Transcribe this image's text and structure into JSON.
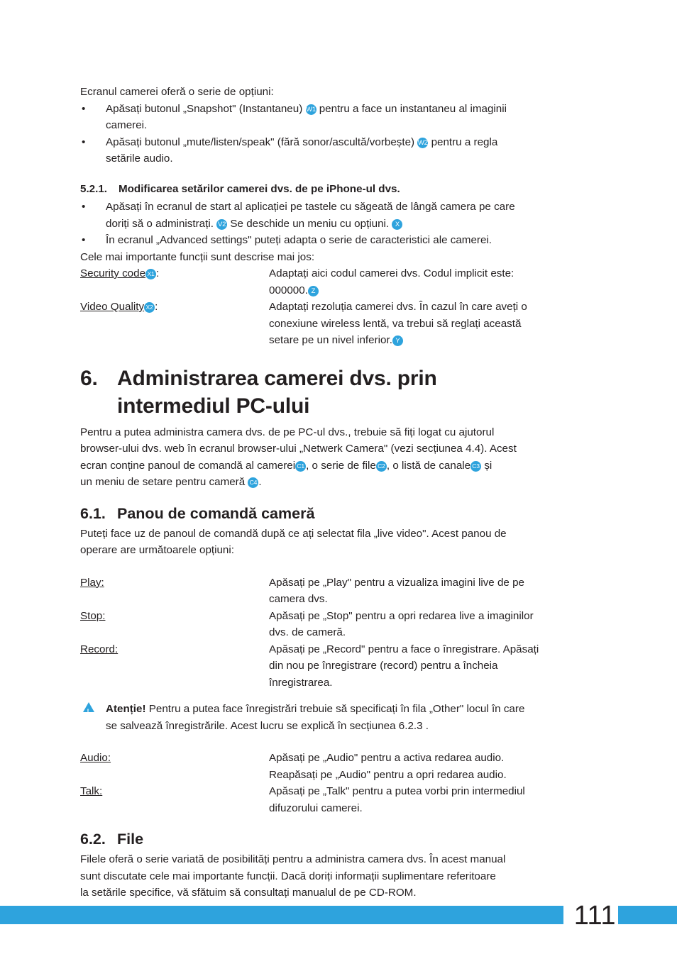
{
  "intro": {
    "lead": "Ecranul camerei oferă o serie de opțiuni:",
    "bullet1_a": "Apăsați butonul „Snapshot\" (Instantaneu)",
    "bullet1_badge": "W1",
    "bullet1_b": "pentru a face un instantaneu al imaginii",
    "bullet1_c": "camerei.",
    "bullet2_a": "Apăsați butonul „mute/listen/speak\" (fără sonor/ascultă/vorbește)",
    "bullet2_badge": "W2",
    "bullet2_b": "pentru a regla",
    "bullet2_c": "setările audio."
  },
  "section521": {
    "number": "5.2.1.",
    "title": "Modificarea setărilor camerei dvs. de pe iPhone-ul dvs.",
    "bullet1_a": "Apăsați în ecranul de start al aplicației pe tastele cu săgeată de lângă camera pe care",
    "bullet1_b": "doriți să o administrați.",
    "bullet1_badge1": "V2",
    "bullet1_c": "Se deschide un meniu cu opțiuni.",
    "bullet1_badge2": "X",
    "bullet2": "În ecranul „Advanced settings\" puteți adapta o serie de caracteristici ale camerei.",
    "after": "Cele mai importante funcții sunt descrise mai jos:",
    "defs": [
      {
        "term": "Security code",
        "term_badge": "X1",
        "term_suffix": ":",
        "desc_line1": "Adaptați aici codul camerei dvs. Codul implicit este:",
        "desc_line2": "000000.",
        "desc_badge": "Z"
      },
      {
        "term": "Video Quality",
        "term_badge": "X2",
        "term_suffix": ":",
        "desc_line1": "Adaptați rezoluția camerei dvs. În cazul în care aveți o",
        "desc_line2": "conexiune wireless lentă, va trebui să reglați această",
        "desc_line3": "setare pe un nivel inferior.",
        "desc_badge": "Y"
      }
    ]
  },
  "chapter6": {
    "number": "6.",
    "title_line1": "Administrarea camerei dvs. prin",
    "title_line2": "intermediul PC-ului",
    "body_line1": "Pentru a putea administra camera dvs. de pe PC-ul dvs., trebuie să fiți logat cu ajutorul",
    "body_line2": "browser-ului dvs. web în ecranul browser-ului „Netwerk Camera\" (vezi secțiunea 4.4). Acest",
    "body_line3_a": "ecran conține panoul de comandă al camerei",
    "body_line3_badge1": "C1",
    "body_line3_b": ", o serie de file",
    "body_line3_badge2": "C2",
    "body_line3_c": ", o listă de canale",
    "body_line3_badge3": "C3",
    "body_line3_d": "și",
    "body_line4_a": "un meniu de setare pentru cameră",
    "body_line4_badge": "C4",
    "body_line4_b": "."
  },
  "section61": {
    "number": "6.1.",
    "title": "Panou de comandă cameră",
    "body_line1": "Puteți face uz de panoul de comandă după ce ați selectat fila „live video\". Acest panou de",
    "body_line2": "operare are următoarele opțiuni:",
    "defs": [
      {
        "term": "Play:",
        "desc_line1": "Apăsați pe „Play\" pentru a vizualiza imagini live de pe",
        "desc_line2": "camera dvs."
      },
      {
        "term": "Stop:",
        "desc_line1": "Apăsați pe „Stop\" pentru a opri redarea live a imaginilor",
        "desc_line2": "dvs. de cameră."
      },
      {
        "term": "Record:",
        "desc_line1": "Apăsați pe „Record\" pentru a face o înregistrare. Apăsați",
        "desc_line2": "din nou pe înregistrare (record) pentru a încheia",
        "desc_line3": "înregistrarea."
      }
    ],
    "warning": {
      "label": "Atenție!",
      "line1": "Pentru a putea face înregistrări trebuie să specificați în fila „Other\" locul în care",
      "line2": "se salvează înregistrările. Acest lucru se explică în secțiunea 6.2.3 ."
    },
    "defs2": [
      {
        "term": "Audio:",
        "desc_line1": "Apăsați pe „Audio\" pentru a activa redarea audio.",
        "desc_line2": "Reapăsați pe „Audio\" pentru a opri redarea audio."
      },
      {
        "term": "Talk:",
        "desc_line1": "Apăsați pe „Talk\" pentru a putea vorbi prin intermediul",
        "desc_line2": "difuzorului camerei."
      }
    ]
  },
  "section62": {
    "number": "6.2.",
    "title": "File",
    "body_line1": "Filele oferă o serie variată de posibilități pentru a administra camera dvs. În acest manual",
    "body_line2": "sunt discutate cele mai importante funcții. Dacă doriți informații suplimentare referitoare",
    "body_line3": "la setările specifice, vă sfătuim să consultați manualul de pe CD-ROM."
  },
  "footer": {
    "page_number": "111",
    "bar_color": "#2ea3dd"
  }
}
